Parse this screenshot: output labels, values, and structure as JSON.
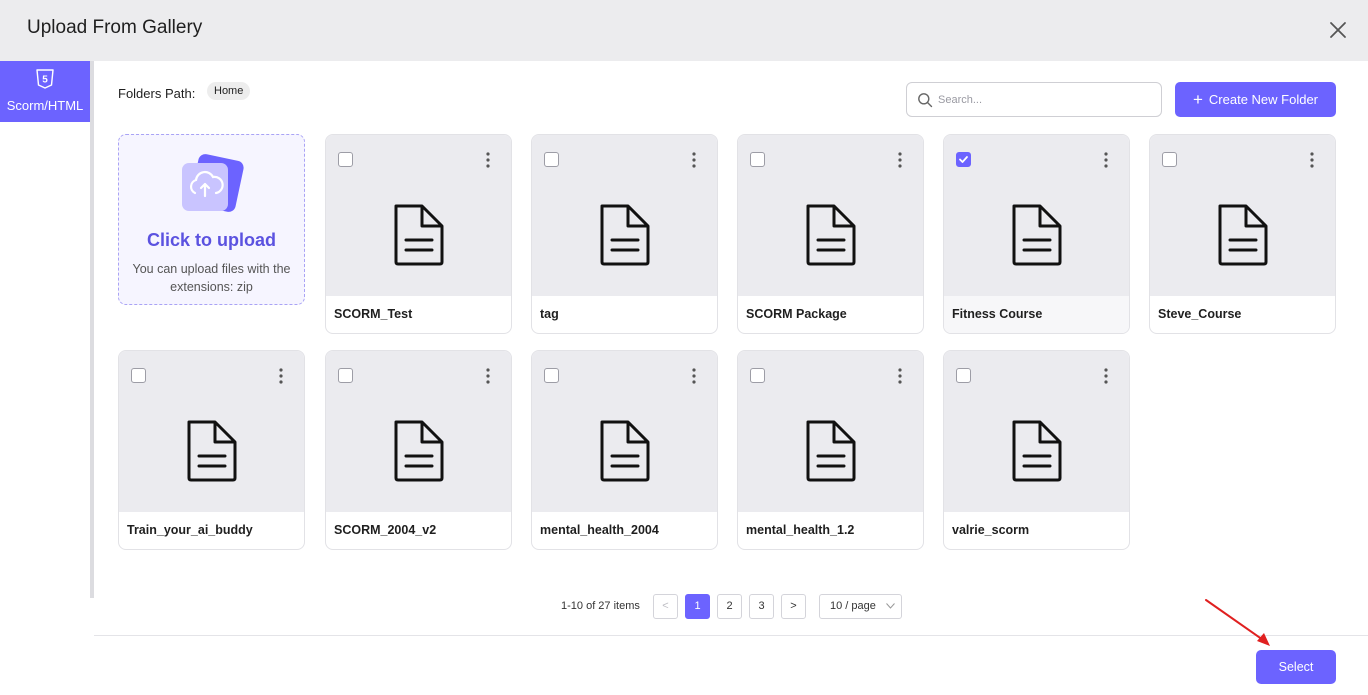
{
  "dialog": {
    "title": "Upload From Gallery"
  },
  "sidebar": {
    "tab_label": "Scorm/HTML",
    "tab_icon": "html5-icon"
  },
  "path": {
    "label": "Folders Path:",
    "crumb": "Home"
  },
  "search": {
    "placeholder": "Search..."
  },
  "toolbar": {
    "create_label": "Create New Folder"
  },
  "upload": {
    "title": "Click to upload",
    "subtitle": "You can upload files with the extensions: zip"
  },
  "files": [
    {
      "name": "SCORM_Test",
      "checked": false
    },
    {
      "name": "tag",
      "checked": false
    },
    {
      "name": "SCORM Package",
      "checked": false
    },
    {
      "name": "Fitness Course",
      "checked": true
    },
    {
      "name": "Steve_Course",
      "checked": false
    },
    {
      "name": "Train_your_ai_buddy",
      "checked": false
    },
    {
      "name": "SCORM_2004_v2",
      "checked": false
    },
    {
      "name": "mental_health_2004",
      "checked": false
    },
    {
      "name": "mental_health_1.2",
      "checked": false
    },
    {
      "name": "valrie_scorm",
      "checked": false
    }
  ],
  "pagination": {
    "summary": "1-10 of 27 items",
    "prev": "<",
    "next": ">",
    "pages": [
      "1",
      "2",
      "3"
    ],
    "current": "1",
    "page_size": "10 / page"
  },
  "footer": {
    "select_label": "Select"
  },
  "colors": {
    "accent": "#6c63ff",
    "annotation_arrow": "#e02020"
  }
}
